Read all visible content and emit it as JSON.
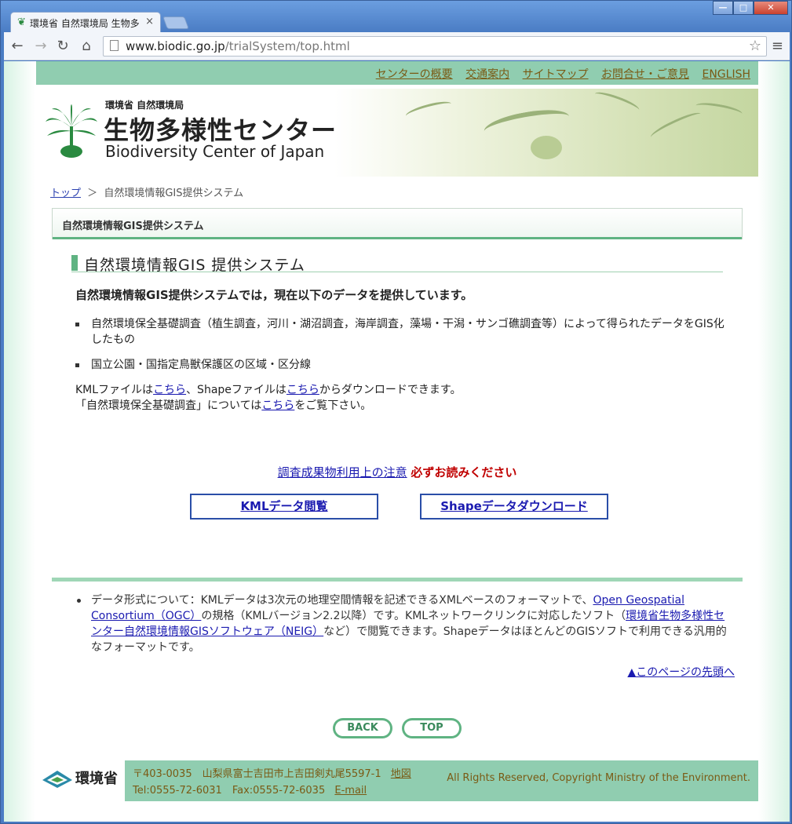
{
  "browser": {
    "tab_title": "環境省 自然環境局 生物多",
    "url": "www.biodic.go.jp/trialSystem/top.html",
    "url_host": "www.biodic.go.jp",
    "url_path": "/trialSystem/top.html"
  },
  "topnav": {
    "items": [
      "センターの概要",
      "交通案内",
      "サイトマップ",
      "お問合せ・ご意見",
      "ENGLISH"
    ]
  },
  "header": {
    "ministry": "環境省 自然環境局",
    "name_jp": "生物多様性センター",
    "name_en": "Biodiversity Center of Japan"
  },
  "breadcrumb": {
    "home": "トップ",
    "sep": "＞",
    "current": "自然環境情報GIS提供システム"
  },
  "box_title": "自然環境情報GIS提供システム",
  "main": {
    "heading": "自然環境情報GIS 提供システム",
    "intro": "自然環境情報GIS提供システムでは，現在以下のデータを提供しています。",
    "bullets": [
      "自然環境保全基礎調査（植生調査，河川・湖沼調査，海岸調査，藻場・干潟・サンゴ礁調査等）によって得られたデータをGIS化したもの",
      "国立公園・国指定鳥獣保護区の区域・区分線"
    ],
    "kml_prefix": "KMLファイルは",
    "kml_link": "こちら",
    "shape_prefix": "、Shapeファイルは",
    "shape_link": "こちら",
    "shape_suffix": "からダウンロードできます。",
    "survey_prefix": "「自然環境保全基礎調査」については",
    "survey_link": "こちら",
    "survey_suffix": "をご覧下さい。",
    "notice_link": "調査成果物利用上の注意",
    "notice_red": "必ずお読みください",
    "kml_button": "KMLデータ閲覧",
    "shape_button": "Shapeデータダウンロード"
  },
  "note": {
    "text1": "データ形式について：KMLデータは3次元の地理空間情報を記述できるXMLベースのフォーマットで、",
    "ogc_link": "Open Geospatial Consortium（OGC）",
    "text2": "の規格（KMLバージョン2.2以降）です。KMLネットワークリンクに対応したソフト（",
    "neig_link": "環境省生物多様性センター自然環境情報GISソフトウェア（NEIG）",
    "text3": "など）で閲覧できます。ShapeデータはほとんどのGISソフトで利用できる汎用的なフォーマットです。"
  },
  "page_top_link": "▲このページの先頭へ",
  "nav_buttons": {
    "back": "BACK",
    "top": "TOP"
  },
  "footer": {
    "ministry": "環境省",
    "address": "〒403-0035　山梨県富士吉田市上吉田剣丸尾5597-1",
    "map_link": "地図",
    "tel": "Tel:0555-72-6031　Fax:0555-72-6035",
    "email_link": "E-mail",
    "copyright": "All Rights Reserved, Copyright Ministry of the Environment."
  },
  "colors": {
    "accent_green": "#90cdb0",
    "bar_green": "#5fb382",
    "link_blue": "#1a1ab0",
    "warning_red": "#c00000",
    "nav_text": "#7a5a14"
  }
}
